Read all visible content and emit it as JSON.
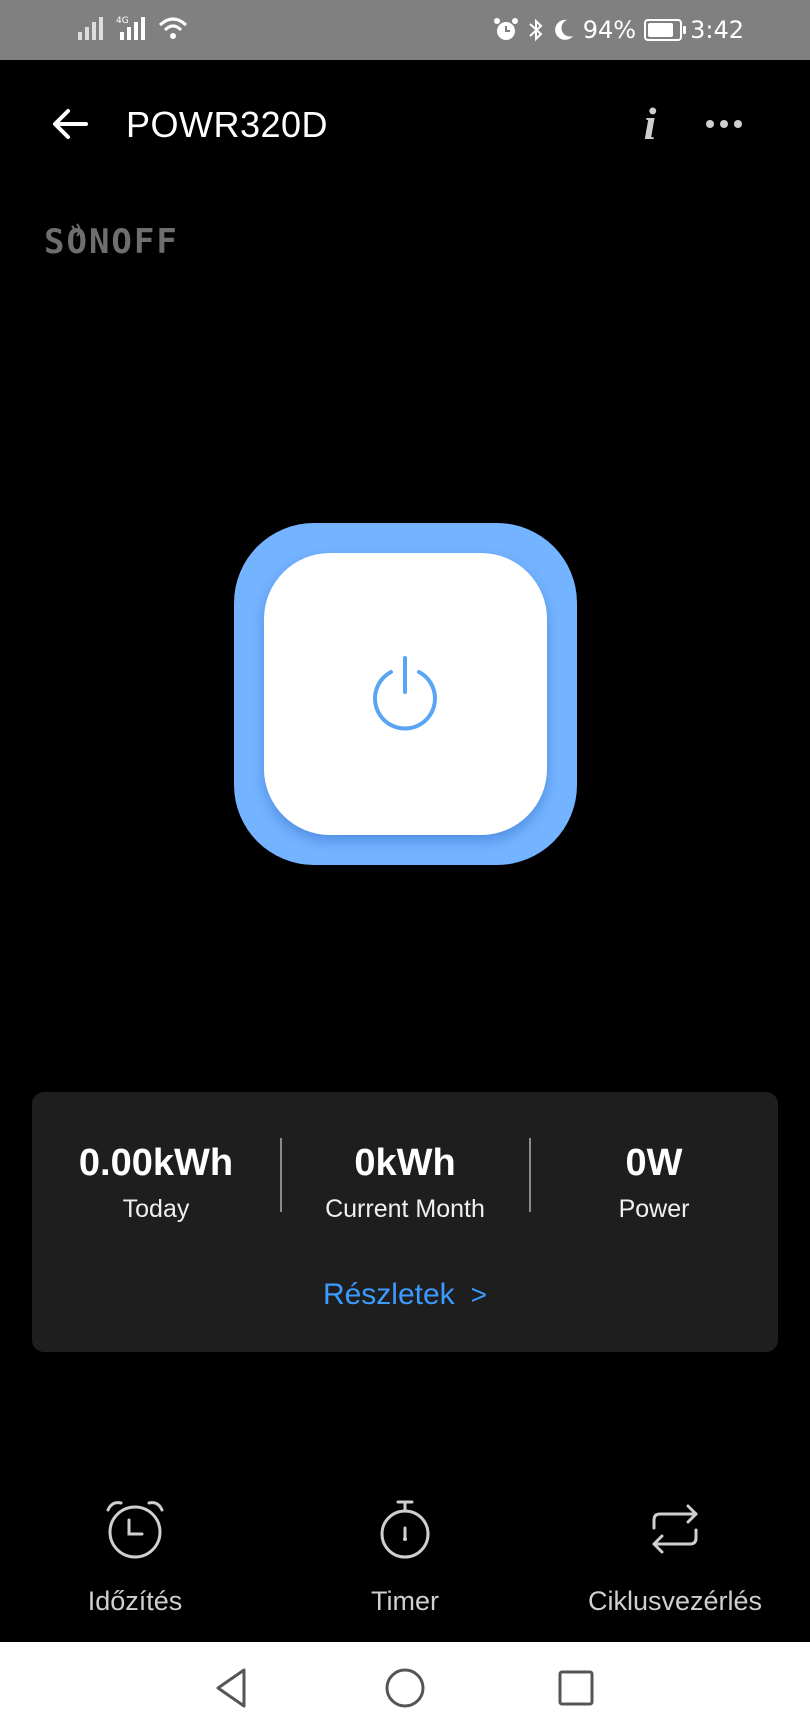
{
  "status_bar": {
    "battery": "94%",
    "time": "3:42",
    "battery_level": 0.94
  },
  "header": {
    "title": "POWR320D"
  },
  "brand": {
    "logo_text": "SONOFF"
  },
  "power_button": {
    "accent_color": "#74b3ff",
    "icon_color": "#5aa4f5"
  },
  "stats": {
    "today": {
      "value": "0.00kWh",
      "label": "Today"
    },
    "month": {
      "value": "0kWh",
      "label": "Current Month"
    },
    "power": {
      "value": "0W",
      "label": "Power"
    },
    "details_label": "Részletek"
  },
  "actions": [
    {
      "label": "Időzítés",
      "icon": "alarm-clock-icon"
    },
    {
      "label": "Timer",
      "icon": "stopwatch-icon"
    },
    {
      "label": "Ciklusvezérlés",
      "icon": "cycle-icon"
    }
  ],
  "colors": {
    "link": "#3b9bff",
    "card_bg": "#1e1e1e"
  }
}
